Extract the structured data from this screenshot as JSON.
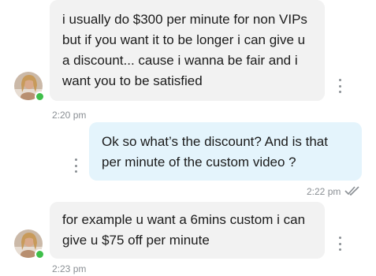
{
  "colors": {
    "incoming_bubble": "#f2f2f2",
    "outgoing_bubble": "#e4f4fc",
    "online_indicator": "#3fbf4a",
    "timestamp": "#8a8f94",
    "read_check": "#8a8f94"
  },
  "messages": [
    {
      "direction": "incoming",
      "lines": [
        "i usually do $300 per minute for non VIPs",
        "but if you want it to be longer i can give u",
        "a discount... cause i wanna be fair and i",
        "want you to be satisfied"
      ],
      "time": "2:20 pm",
      "avatar_icon": "user-avatar",
      "options_icon": "kebab-menu-icon"
    },
    {
      "direction": "outgoing",
      "lines": [
        "Ok so what’s the discount? And is that",
        "per minute of the custom video ?"
      ],
      "time": "2:22 pm",
      "status_icon": "double-check-icon",
      "options_icon": "kebab-menu-icon"
    },
    {
      "direction": "incoming",
      "lines": [
        "for example u want a 6mins custom i can",
        "give u $75 off per minute"
      ],
      "time": "2:23 pm",
      "avatar_icon": "user-avatar",
      "options_icon": "kebab-menu-icon"
    }
  ]
}
